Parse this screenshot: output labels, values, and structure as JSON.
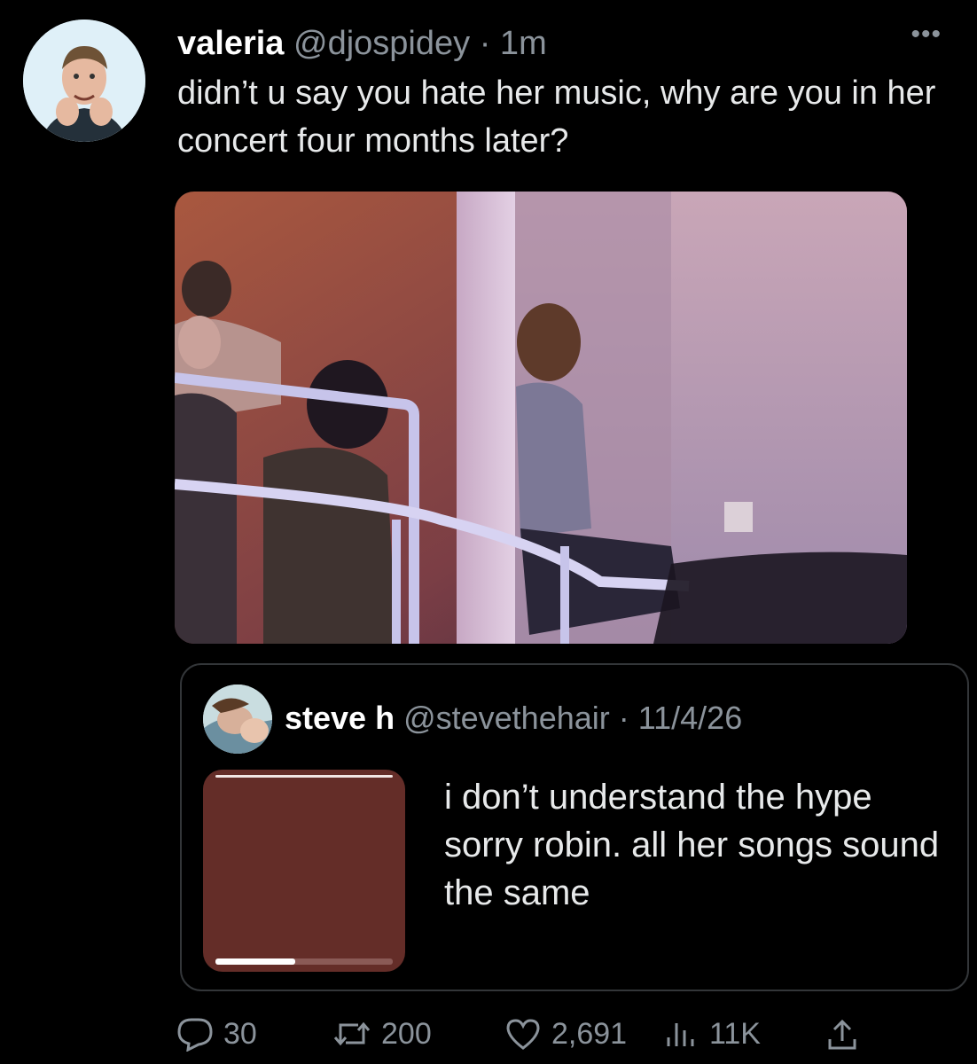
{
  "tweet": {
    "display_name": "valeria",
    "handle": "@djospidey",
    "time": "· 1m",
    "text": "didn’t u say you hate her music, why are you in her concert four months later?",
    "more_label": "•••"
  },
  "quoted": {
    "display_name": "steve h",
    "handle": "@stevethehair",
    "date": "· 11/4/26",
    "text": "i don’t understand the hype sorry robin. all her songs sound the same",
    "media_progress": 0.45
  },
  "actions": {
    "replies": "30",
    "retweets": "200",
    "likes": "2,691",
    "views": "11K"
  },
  "icons": [
    "more-icon",
    "reply-icon",
    "retweet-icon",
    "like-icon",
    "views-icon",
    "share-icon"
  ],
  "colors": {
    "background": "#000000",
    "text": "#e7e9ea",
    "muted": "#8b939b",
    "border": "#333639",
    "media": "#642d28"
  }
}
